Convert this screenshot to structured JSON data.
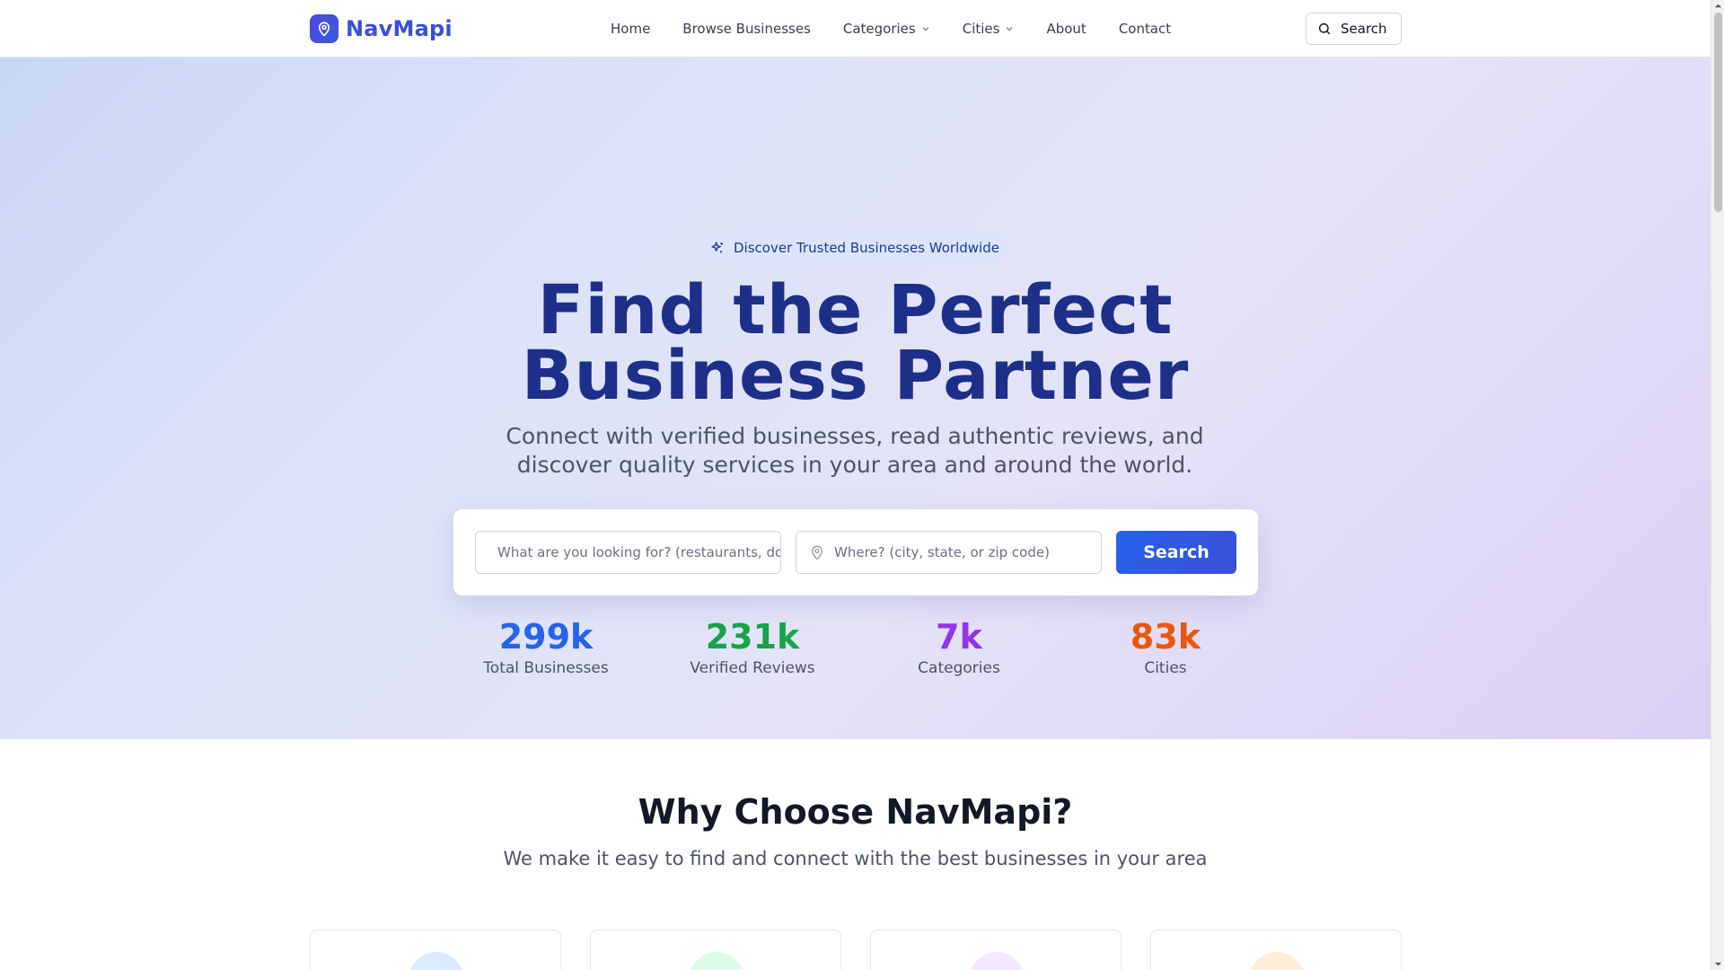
{
  "navbar": {
    "brand": "NavMapi",
    "links": [
      {
        "label": "Home"
      },
      {
        "label": "Browse Businesses"
      },
      {
        "label": "Categories"
      },
      {
        "label": "Cities"
      },
      {
        "label": "About"
      },
      {
        "label": "Contact"
      }
    ],
    "search_label": "Search"
  },
  "hero": {
    "badge": "Discover Trusted Businesses Worldwide",
    "title_line1": "Find the Perfect",
    "title_line2": "Business Partner",
    "subtitle_line1": "Connect with verified businesses, read authentic reviews, and",
    "subtitle_line2": "discover quality services in your area and around the world.",
    "search": {
      "what_placeholder": "What are you looking for? (restaurants, doctors...)",
      "where_placeholder": "Where? (city, state, or zip code)",
      "button_label": "Search"
    },
    "stats": [
      {
        "value": "299k",
        "label": "Total Businesses"
      },
      {
        "value": "231k",
        "label": "Verified Reviews"
      },
      {
        "value": "7k",
        "label": "Categories"
      },
      {
        "value": "83k",
        "label": "Cities"
      }
    ]
  },
  "why": {
    "title": "Why Choose NavMapi?",
    "subtitle": "We make it easy to find and connect with the best businesses in your area"
  },
  "colors": {
    "brand": "#3b4fd8",
    "stat_businesses": "#2563eb",
    "stat_reviews": "#16a34a",
    "stat_categories": "#9333ea",
    "stat_cities": "#ea580c"
  }
}
